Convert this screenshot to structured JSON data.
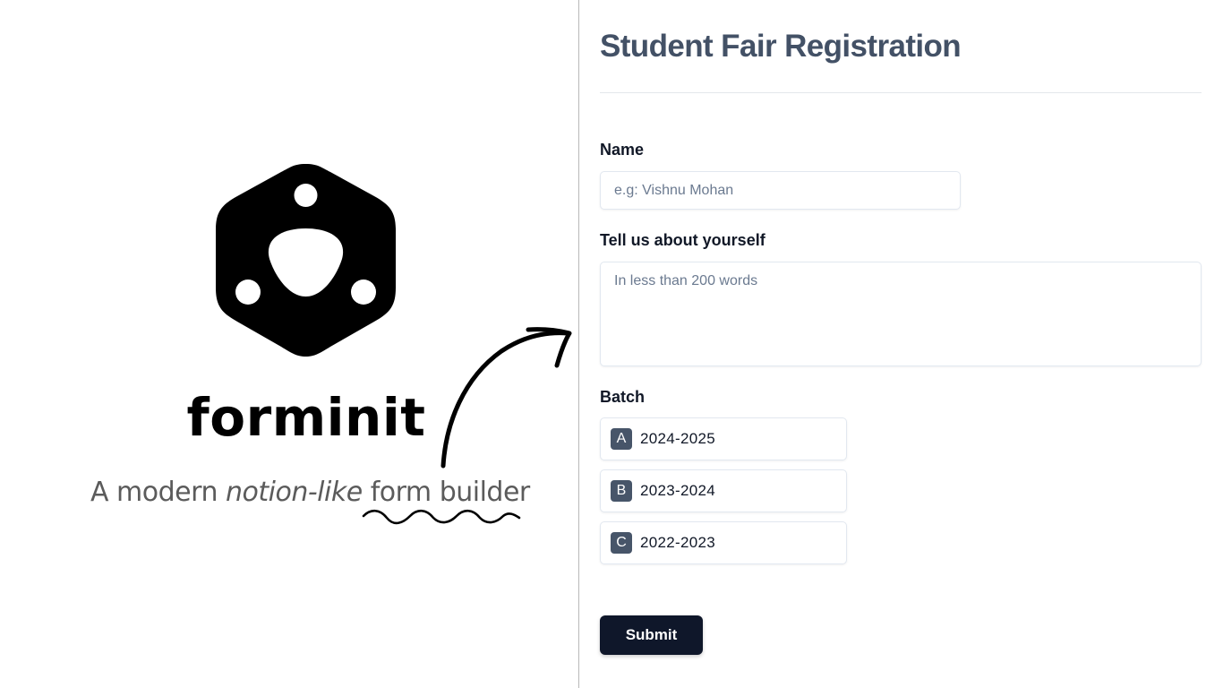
{
  "brand": {
    "name": "forminit",
    "tagline_start": "A modern ",
    "tagline_emphasis": "notion-like",
    "tagline_end": " form builder",
    "logo_icon": "hexagon-logo-icon"
  },
  "form": {
    "title": "Student Fair Registration",
    "name_label": "Name",
    "name_placeholder": "e.g: Vishnu Mohan",
    "about_label": "Tell us about yourself",
    "about_placeholder": "In less than 200 words",
    "batch_label": "Batch",
    "batch_options": [
      {
        "key": "A",
        "label": "2024-2025"
      },
      {
        "key": "B",
        "label": "2023-2024"
      },
      {
        "key": "C",
        "label": "2022-2023"
      }
    ],
    "submit_label": "Submit"
  },
  "colors": {
    "title": "#435166",
    "key_badge": "#475569",
    "submit_bg": "#0f172a"
  }
}
